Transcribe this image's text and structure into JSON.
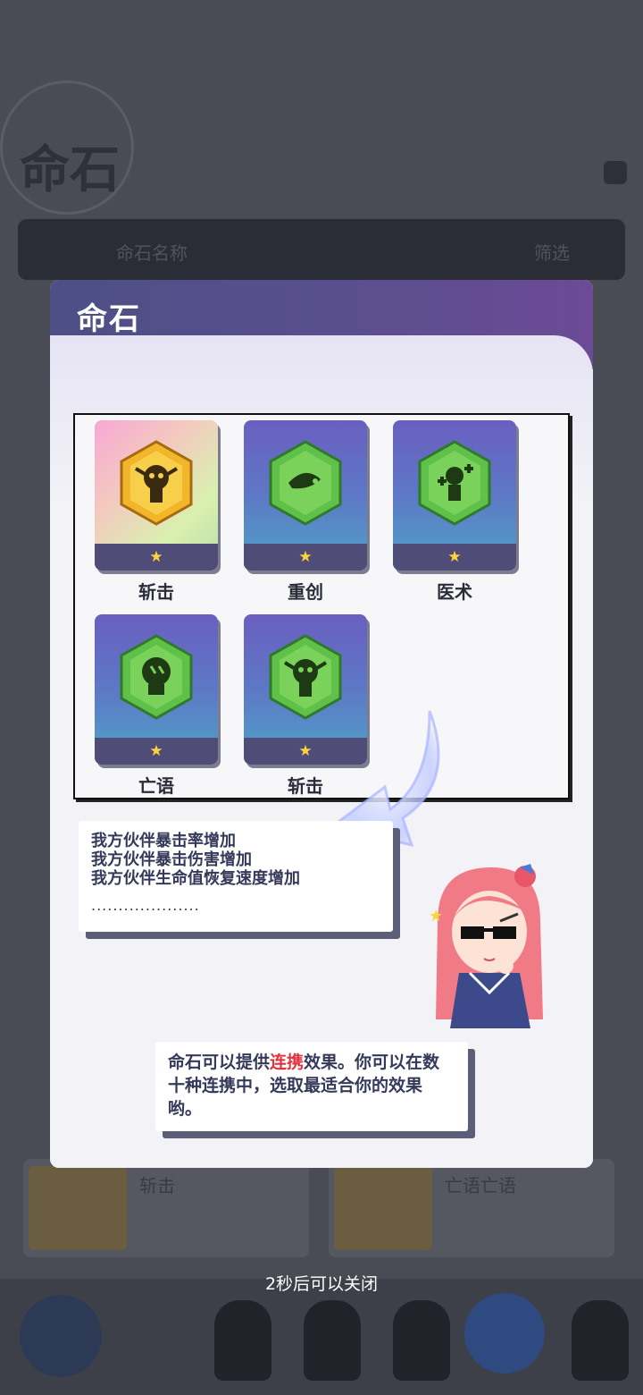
{
  "background": {
    "title": "命石",
    "search_label": "命石名称",
    "search_button": "筛选",
    "cards": [
      {
        "title": "斩击"
      },
      {
        "title": "亡语亡语"
      }
    ]
  },
  "modal": {
    "title": "命石",
    "stones": [
      {
        "name": "斩击",
        "stars": "★",
        "rarity": "gold",
        "icon": "skull-gem-icon"
      },
      {
        "name": "重创",
        "stars": "★",
        "rarity": "green",
        "icon": "whip-gem-icon"
      },
      {
        "name": "医术",
        "stars": "★",
        "rarity": "green",
        "icon": "medic-gem-icon"
      },
      {
        "name": "亡语",
        "stars": "★",
        "rarity": "green",
        "icon": "skull-mouth-gem-icon"
      },
      {
        "name": "斩击",
        "stars": "★",
        "rarity": "green",
        "icon": "skull-gem-icon"
      }
    ],
    "effects": [
      "我方伙伴暴击率增加",
      "我方伙伴暴击伤害增加",
      "我方伙伴生命值恢复速度增加"
    ],
    "effects_more": "....................",
    "info": {
      "prefix": "命石可以提供",
      "highlight": "连携",
      "suffix": "效果。你可以在数十种连携中，选取最适合你的效果哟。"
    }
  },
  "close_hint": "2秒后可以关闭",
  "colors": {
    "header": "#5a4f8e",
    "highlight": "#e0333f",
    "star": "#ffd43a"
  }
}
